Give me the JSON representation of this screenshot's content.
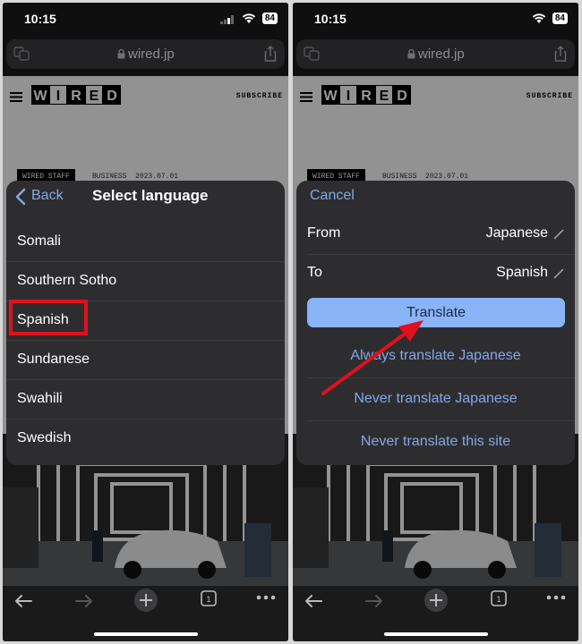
{
  "status": {
    "time": "10:15",
    "battery": "84"
  },
  "browser": {
    "url": "wired.jp"
  },
  "webpage": {
    "logo_text": "WIRED",
    "subscribe": "SUBSCRIBE",
    "tag": "WIRED STAFF",
    "category": "BUSINESS",
    "date": "2023.07.01"
  },
  "select_language": {
    "back_label": "Back",
    "title": "Select language",
    "languages": [
      "Somali",
      "Southern Sotho",
      "Spanish",
      "Sundanese",
      "Swahili",
      "Swedish"
    ],
    "highlighted": "Spanish"
  },
  "translate_sheet": {
    "cancel_label": "Cancel",
    "from_label": "From",
    "from_value": "Japanese",
    "to_label": "To",
    "to_value": "Spanish",
    "translate_button": "Translate",
    "options": [
      "Always translate Japanese",
      "Never translate Japanese",
      "Never translate this site"
    ]
  },
  "toolbar": {
    "tab_count": "1"
  },
  "colors": {
    "accent": "#8ab4f8",
    "link": "#85a8e6",
    "sheet_bg": "#2d2d30",
    "highlight": "#e0101e",
    "arrow": "#e0101e"
  }
}
